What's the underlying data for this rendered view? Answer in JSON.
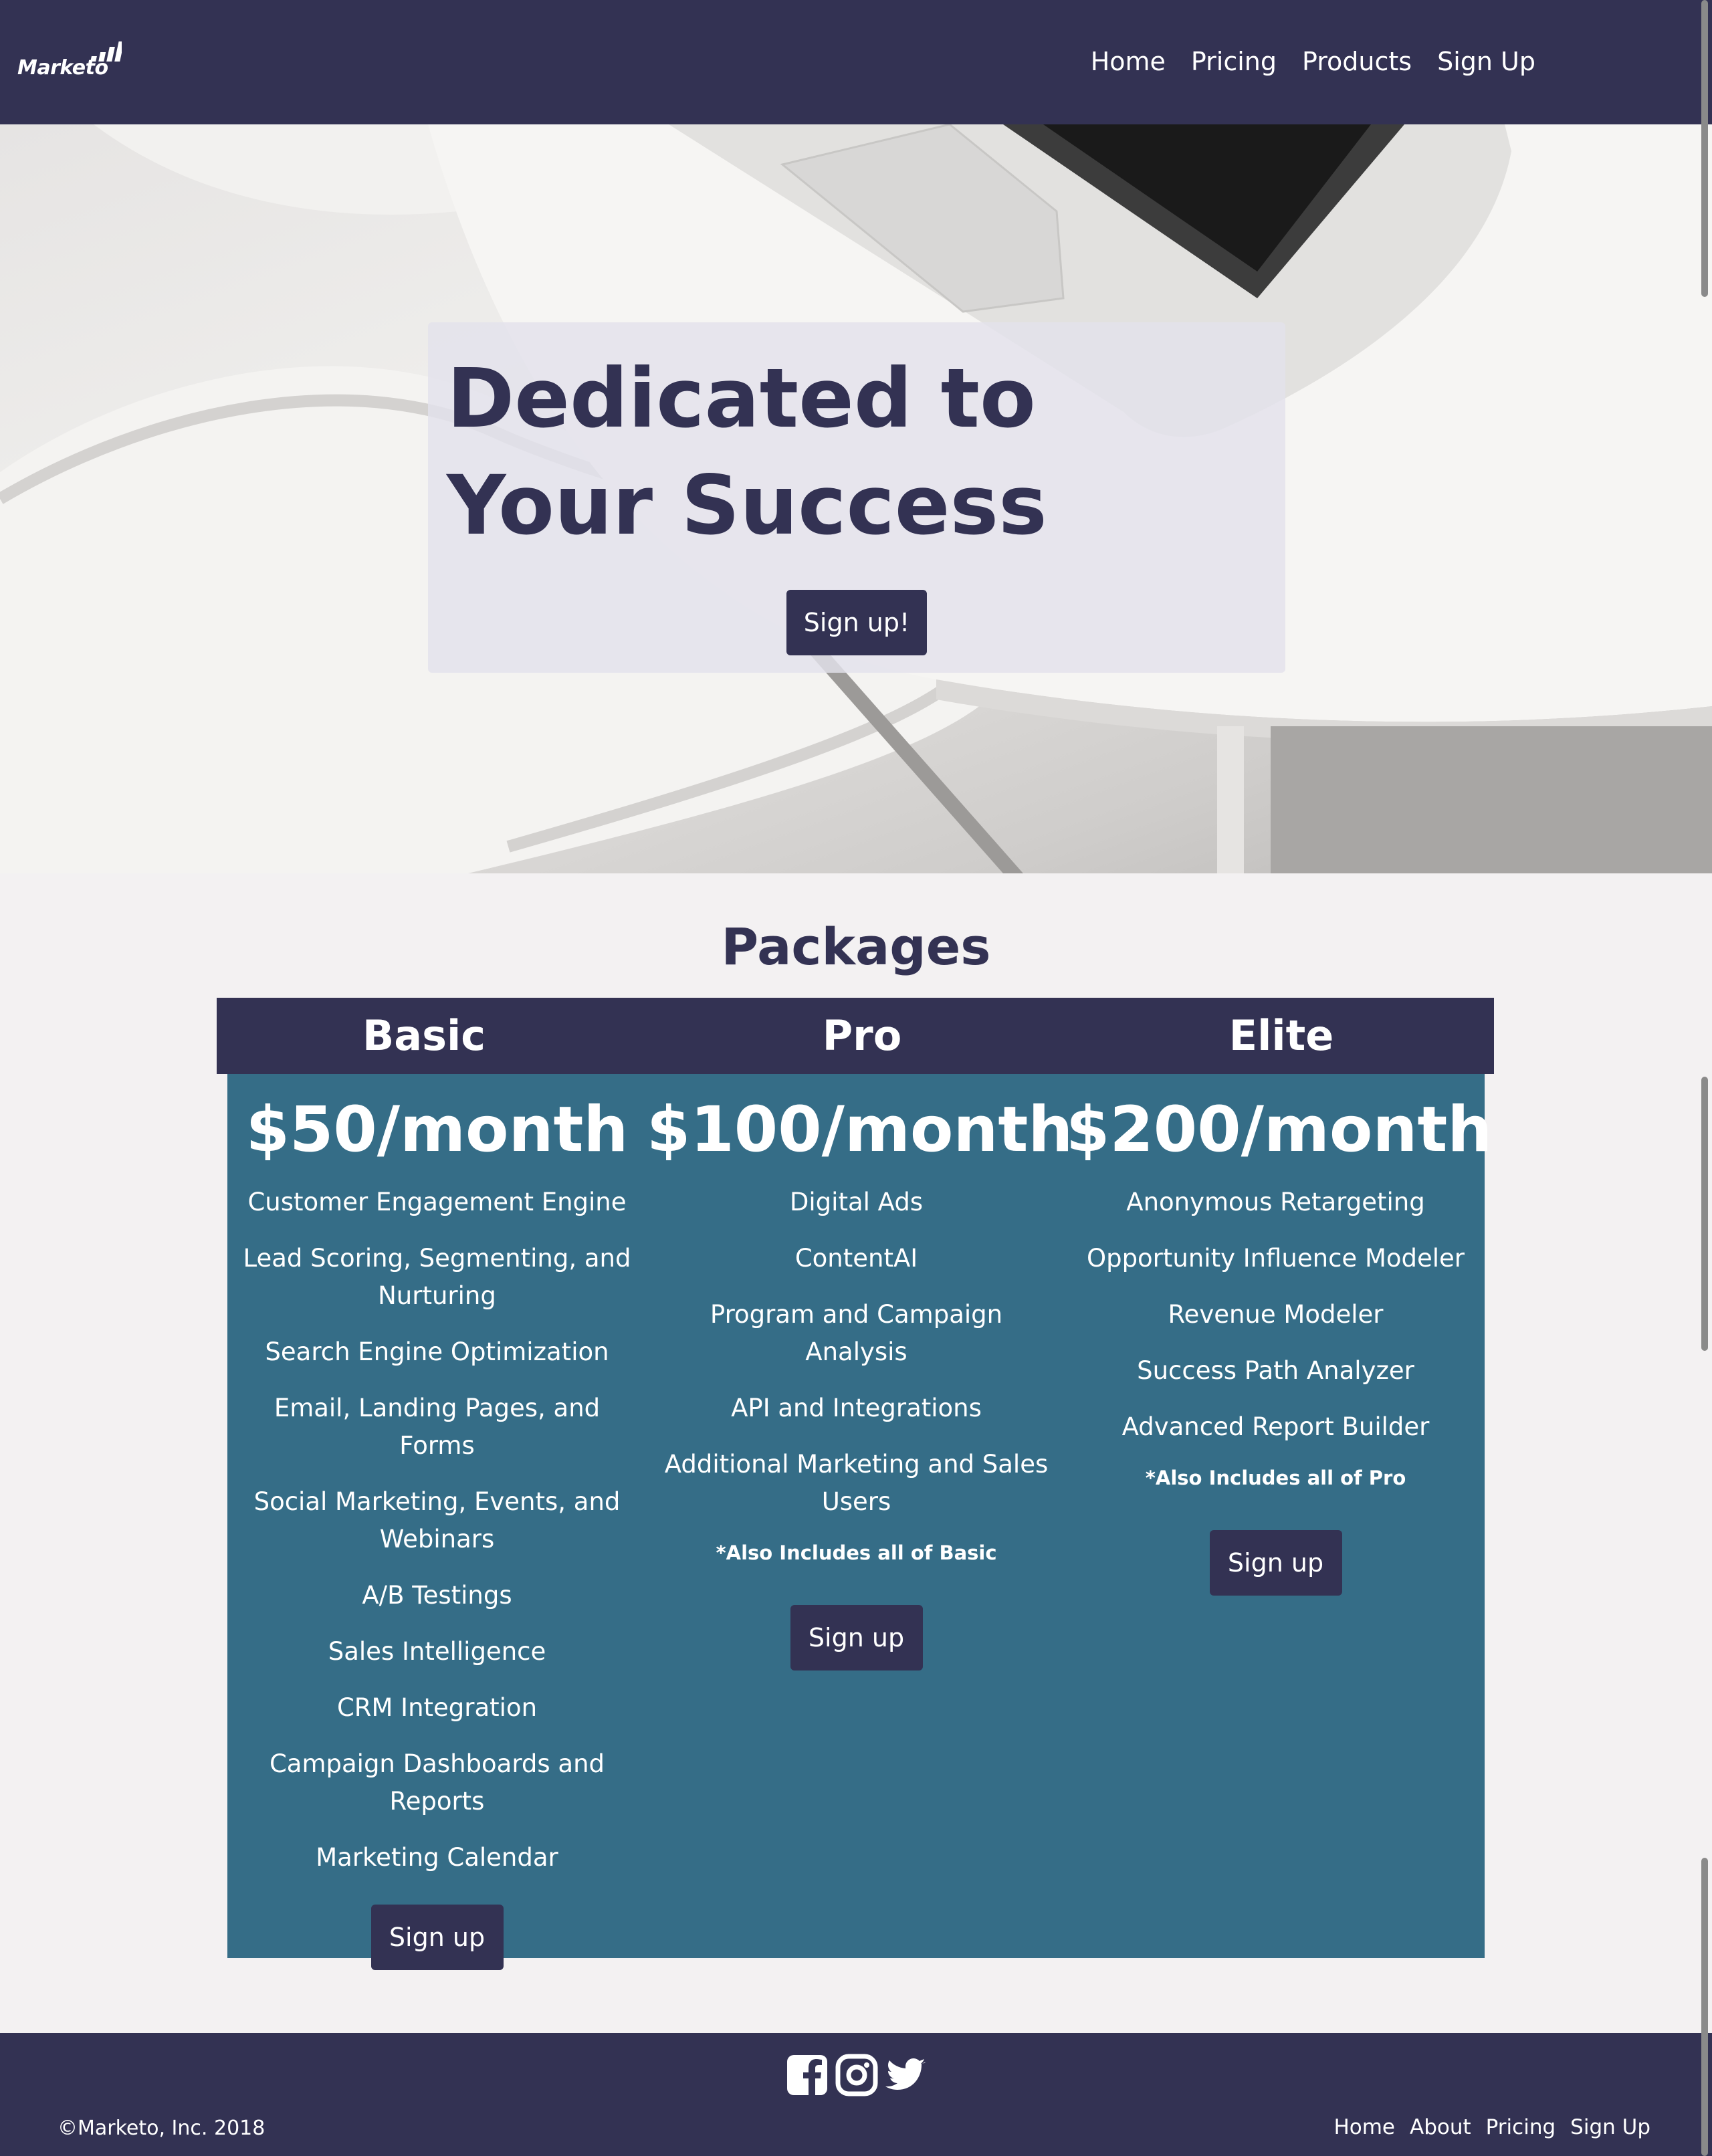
{
  "navbar": {
    "brand": "Marketo",
    "links": [
      "Home",
      "Pricing",
      "Products",
      "Sign Up"
    ],
    "bg_color": "#333253"
  },
  "hero": {
    "title": "Dedicated to Your Success",
    "cta_label": "Sign up!"
  },
  "packages": {
    "title": "Packages",
    "plans": [
      {
        "name": "Basic",
        "price": "$50/month",
        "features": [
          "Customer Engagement Engine",
          "Lead Scoring, Segmenting, and Nurturing",
          "Search Engine Optimization",
          "Email, Landing Pages, and Forms",
          "Social Marketing, Events, and Webinars",
          "A/B Testings",
          "Sales Intelligence",
          "CRM Integration",
          "Campaign Dashboards and Reports",
          "Marketing Calendar"
        ],
        "note": "",
        "button_label": "Sign up"
      },
      {
        "name": "Pro",
        "price": "$100/month",
        "features": [
          "Digital Ads",
          "ContentAI",
          "Program and Campaign Analysis",
          "API and Integrations",
          "Additional Marketing and Sales Users"
        ],
        "note": "*Also Includes all of Basic",
        "button_label": "Sign up"
      },
      {
        "name": "Elite",
        "price": "$200/month",
        "features": [
          "Anonymous Retargeting",
          "Opportunity Influence Modeler",
          "Revenue Modeler",
          "Success Path Analyzer",
          "Advanced Report Builder"
        ],
        "note": "*Also Includes all of Pro",
        "button_label": "Sign up"
      }
    ],
    "header_color": "#333253",
    "body_color": "#356d87"
  },
  "footer": {
    "social_icons": [
      "facebook-icon",
      "instagram-icon",
      "twitter-icon"
    ],
    "copyright": "©Marketo, Inc. 2018",
    "links": [
      "Home",
      "About",
      "Pricing",
      "Sign Up"
    ]
  }
}
